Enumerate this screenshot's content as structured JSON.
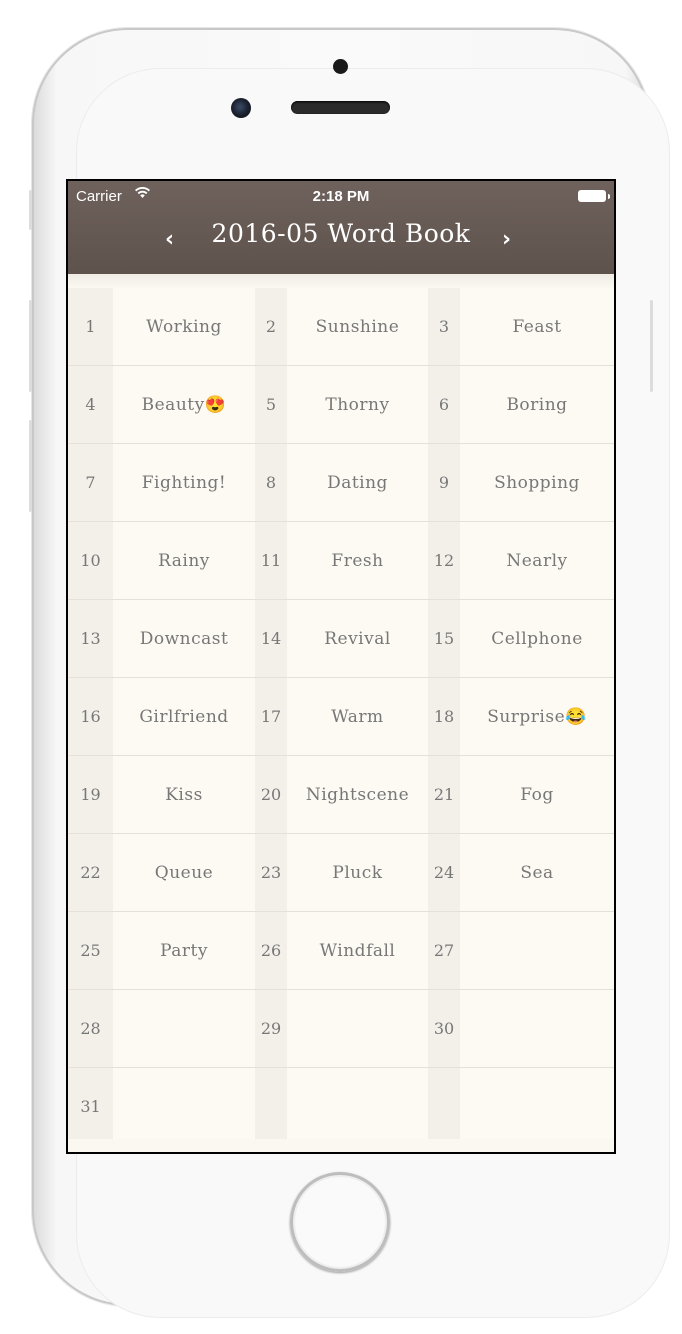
{
  "status_bar": {
    "carrier": "Carrier",
    "time": "2:18 PM"
  },
  "nav": {
    "title": "2016-05 Word Book",
    "prev": "‹",
    "next": "›"
  },
  "calendar": {
    "rows": [
      [
        {
          "day": "1",
          "word": "Working"
        },
        {
          "day": "2",
          "word": "Sunshine"
        },
        {
          "day": "3",
          "word": "Feast"
        }
      ],
      [
        {
          "day": "4",
          "word": "Beauty😍"
        },
        {
          "day": "5",
          "word": "Thorny"
        },
        {
          "day": "6",
          "word": "Boring"
        }
      ],
      [
        {
          "day": "7",
          "word": "Fighting!"
        },
        {
          "day": "8",
          "word": "Dating"
        },
        {
          "day": "9",
          "word": "Shopping"
        }
      ],
      [
        {
          "day": "10",
          "word": "Rainy"
        },
        {
          "day": "11",
          "word": "Fresh"
        },
        {
          "day": "12",
          "word": "Nearly"
        }
      ],
      [
        {
          "day": "13",
          "word": "Downcast"
        },
        {
          "day": "14",
          "word": "Revival"
        },
        {
          "day": "15",
          "word": "Cellphone"
        }
      ],
      [
        {
          "day": "16",
          "word": "Girlfriend"
        },
        {
          "day": "17",
          "word": "Warm"
        },
        {
          "day": "18",
          "word": "Surprise😂"
        }
      ],
      [
        {
          "day": "19",
          "word": "Kiss"
        },
        {
          "day": "20",
          "word": "Nightscene"
        },
        {
          "day": "21",
          "word": "Fog"
        }
      ],
      [
        {
          "day": "22",
          "word": "Queue"
        },
        {
          "day": "23",
          "word": "Pluck"
        },
        {
          "day": "24",
          "word": "Sea"
        }
      ],
      [
        {
          "day": "25",
          "word": "Party"
        },
        {
          "day": "26",
          "word": "Windfall"
        },
        {
          "day": "27",
          "word": ""
        }
      ],
      [
        {
          "day": "28",
          "word": ""
        },
        {
          "day": "29",
          "word": ""
        },
        {
          "day": "30",
          "word": ""
        }
      ],
      [
        {
          "day": "31",
          "word": ""
        },
        {
          "day": "",
          "word": ""
        },
        {
          "day": "",
          "word": ""
        }
      ]
    ]
  },
  "colors": {
    "nav_bar": "#655852",
    "cell_bg": "#fdfaf3",
    "number_bg": "#f3f0ea",
    "text": "#777777"
  }
}
